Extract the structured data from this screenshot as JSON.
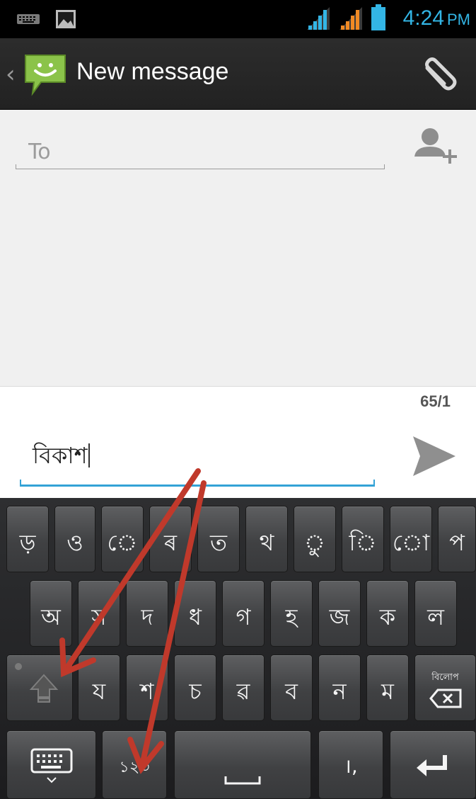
{
  "status_bar": {
    "time": "4:24",
    "ampm": "PM",
    "icons": [
      "keyboard-icon",
      "image-icon",
      "signal-icon",
      "signal-icon",
      "battery-icon"
    ]
  },
  "action_bar": {
    "title": "New message",
    "icons": [
      "back-chevron",
      "messaging-app-icon",
      "paperclip-icon"
    ]
  },
  "compose": {
    "to_placeholder": "To",
    "add_contact_icon": "add-contact-icon"
  },
  "message": {
    "char_counter": "65/1",
    "text": "বিকাশ",
    "send_icon": "send-icon"
  },
  "keyboard": {
    "rows": [
      [
        "ড়",
        "ও",
        "ে",
        "ৰ",
        "ত",
        "থ",
        "ু",
        "ি",
        "ো",
        "প"
      ],
      [
        "অ",
        "স",
        "দ",
        "ধ",
        "গ",
        "হ",
        "জ",
        "ক",
        "ল"
      ],
      [
        "shift",
        "য",
        "শ",
        "চ",
        "ৱ",
        "ব",
        "ন",
        "ম",
        "delete"
      ],
      [
        "keyboard-switch",
        "১২৩",
        "space",
        "।,",
        "enter"
      ]
    ],
    "row1": [
      "ড়",
      "ও",
      "ে",
      "ৰ",
      "ত",
      "থ",
      "ু",
      "ি",
      "ো",
      "প"
    ],
    "row2": [
      "অ",
      "স",
      "দ",
      "ধ",
      "গ",
      "হ",
      "জ",
      "ক",
      "ল"
    ],
    "row3": [
      "য",
      "শ",
      "চ",
      "ৱ",
      "ব",
      "ন",
      "ম"
    ],
    "delete_label": "বিলোপ",
    "numeric_label": "১২৩",
    "punct_label": "।,"
  },
  "colors": {
    "accent_blue": "#33b5e5",
    "annotation_arrow": "#c0392b",
    "app_icon_green": "#8bc34a"
  }
}
